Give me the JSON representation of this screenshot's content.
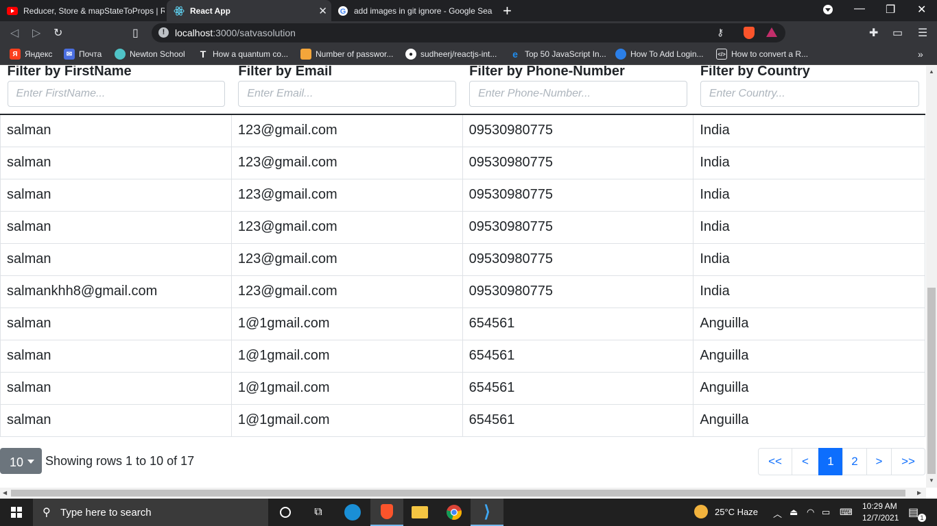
{
  "browser": {
    "tabs": [
      {
        "title": "Reducer, Store & mapStateToProps | R",
        "icon": "youtube-icon",
        "active": false
      },
      {
        "title": "React App",
        "icon": "react-icon",
        "active": true
      },
      {
        "title": "add images in git ignore - Google Sea",
        "icon": "google-icon",
        "active": false
      }
    ],
    "url_host": "localhost",
    "url_rest": ":3000/satvasolution",
    "bookmarks": [
      {
        "label": "Яндекс",
        "icon": "yandex-icon"
      },
      {
        "label": "Почта",
        "icon": "mail-icon"
      },
      {
        "label": "Newton School",
        "icon": "newton-school-icon"
      },
      {
        "label": "How a quantum co...",
        "icon": "t-icon"
      },
      {
        "label": "Number of passwor...",
        "icon": "bookmark-icon"
      },
      {
        "label": "sudheerj/reactjs-int...",
        "icon": "github-icon"
      },
      {
        "label": "Top 50 JavaScript In...",
        "icon": "edureka-icon"
      },
      {
        "label": "How To Add Login...",
        "icon": "bookmark-icon"
      },
      {
        "label": "How to convert a R...",
        "icon": "code-icon"
      }
    ]
  },
  "table": {
    "headers": [
      {
        "label": "Filter by FirstName",
        "placeholder": "Enter FirstName..."
      },
      {
        "label": "Filter by Email",
        "placeholder": "Enter Email..."
      },
      {
        "label": "Filter by Phone-Number",
        "placeholder": "Enter Phone-Number..."
      },
      {
        "label": "Filter by Country",
        "placeholder": "Enter Country..."
      }
    ],
    "rows": [
      [
        "salman",
        "123@gmail.com",
        "09530980775",
        "India"
      ],
      [
        "salman",
        "123@gmail.com",
        "09530980775",
        "India"
      ],
      [
        "salman",
        "123@gmail.com",
        "09530980775",
        "India"
      ],
      [
        "salman",
        "123@gmail.com",
        "09530980775",
        "India"
      ],
      [
        "salman",
        "123@gmail.com",
        "09530980775",
        "India"
      ],
      [
        "salmankhh8@gmail.com",
        "123@gmail.com",
        "09530980775",
        "India"
      ],
      [
        "salman",
        "1@1gmail.com",
        "654561",
        "Anguilla"
      ],
      [
        "salman",
        "1@1gmail.com",
        "654561",
        "Anguilla"
      ],
      [
        "salman",
        "1@1gmail.com",
        "654561",
        "Anguilla"
      ],
      [
        "salman",
        "1@1gmail.com",
        "654561",
        "Anguilla"
      ]
    ]
  },
  "pagination": {
    "page_size": "10",
    "showing": "Showing rows 1 to 10 of 17",
    "buttons": [
      "<<",
      "<",
      "1",
      "2",
      ">",
      ">>"
    ],
    "active": "1",
    "colors": {
      "primary": "#0d6efd",
      "secondary": "#6c757d"
    }
  },
  "taskbar": {
    "search_placeholder": "Type here to search",
    "weather": "25°C  Haze",
    "time": "10:29 AM",
    "date": "12/7/2021",
    "notifications": "1"
  }
}
